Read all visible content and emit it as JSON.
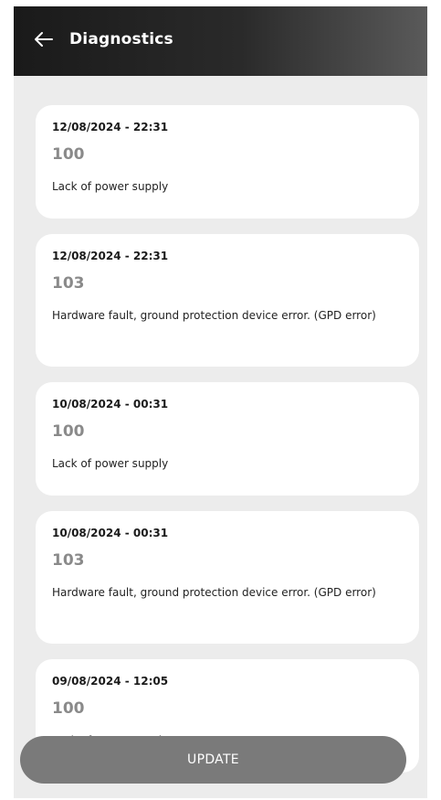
{
  "header": {
    "title": "Diagnostics",
    "back_icon": "arrow-left-icon"
  },
  "entries": [
    {
      "date": "12/08/2024 - 22:31",
      "code": "100",
      "description": "Lack of power supply"
    },
    {
      "date": "12/08/2024 - 22:31",
      "code": "103",
      "description": "Hardware fault, ground protection device error. (GPD error)"
    },
    {
      "date": "10/08/2024 - 00:31",
      "code": "100",
      "description": "Lack of power supply"
    },
    {
      "date": "10/08/2024 - 00:31",
      "code": "103",
      "description": "Hardware fault, ground protection device error. (GPD error)"
    },
    {
      "date": "09/08/2024 - 12:05",
      "code": "100",
      "description": "Lack of power supply"
    }
  ],
  "update_label": "UPDATE",
  "colors": {
    "header_bg": "#1a1a1a",
    "screen_bg": "#ececec",
    "card_bg": "#ffffff",
    "code_text": "#8a8a8a",
    "button_bg": "#7a7a7a"
  }
}
